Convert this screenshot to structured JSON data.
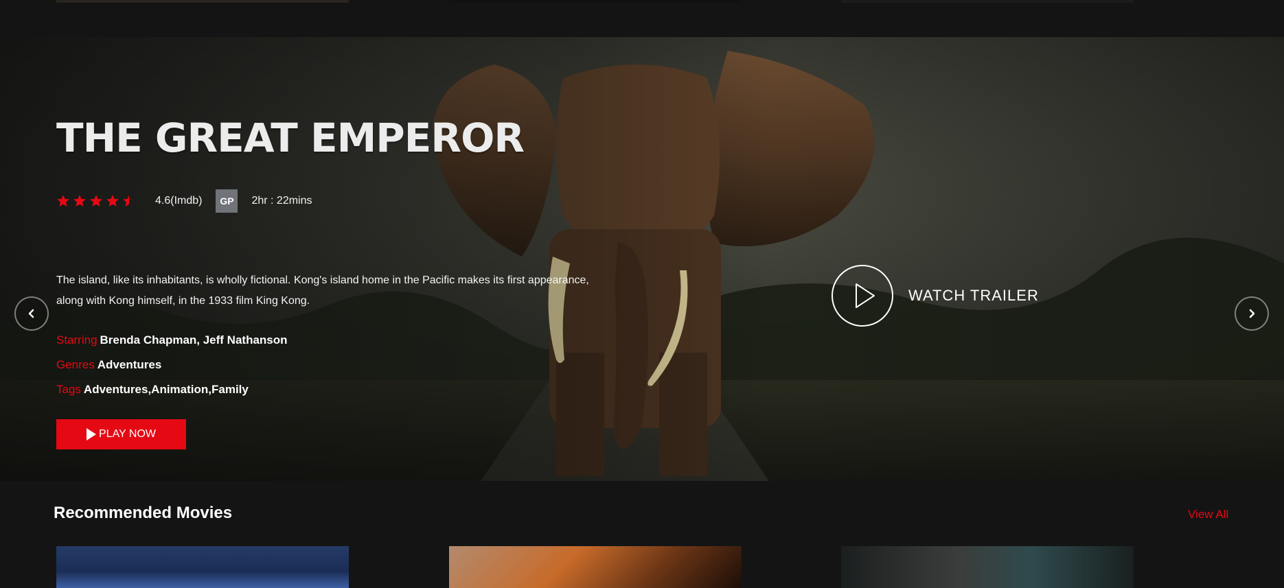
{
  "hero": {
    "title": "THE GREAT EMPEROR",
    "rating": {
      "stars": 4.5,
      "max_stars": 5,
      "text": "4.6(Imdb)"
    },
    "badge": "GP",
    "duration": "2hr : 22mins",
    "description": "The island, like its inhabitants, is wholly fictional. Kong's island home in the Pacific makes its first appearance, along with Kong himself, in the 1933 film King Kong.",
    "starring": {
      "label": "Starring",
      "value": "Brenda Chapman, Jeff Nathanson"
    },
    "genres": {
      "label": "Genres",
      "value": "Adventures"
    },
    "tags": {
      "label": "Tags",
      "value": "Adventures,Animation,Family"
    },
    "play_button": "PLAY NOW",
    "trailer_label": "WATCH TRAILER"
  },
  "recommended": {
    "title": "Recommended Movies",
    "view_all": "View All"
  },
  "colors": {
    "accent": "#e50914",
    "background": "#141414",
    "badge": "#707479"
  }
}
